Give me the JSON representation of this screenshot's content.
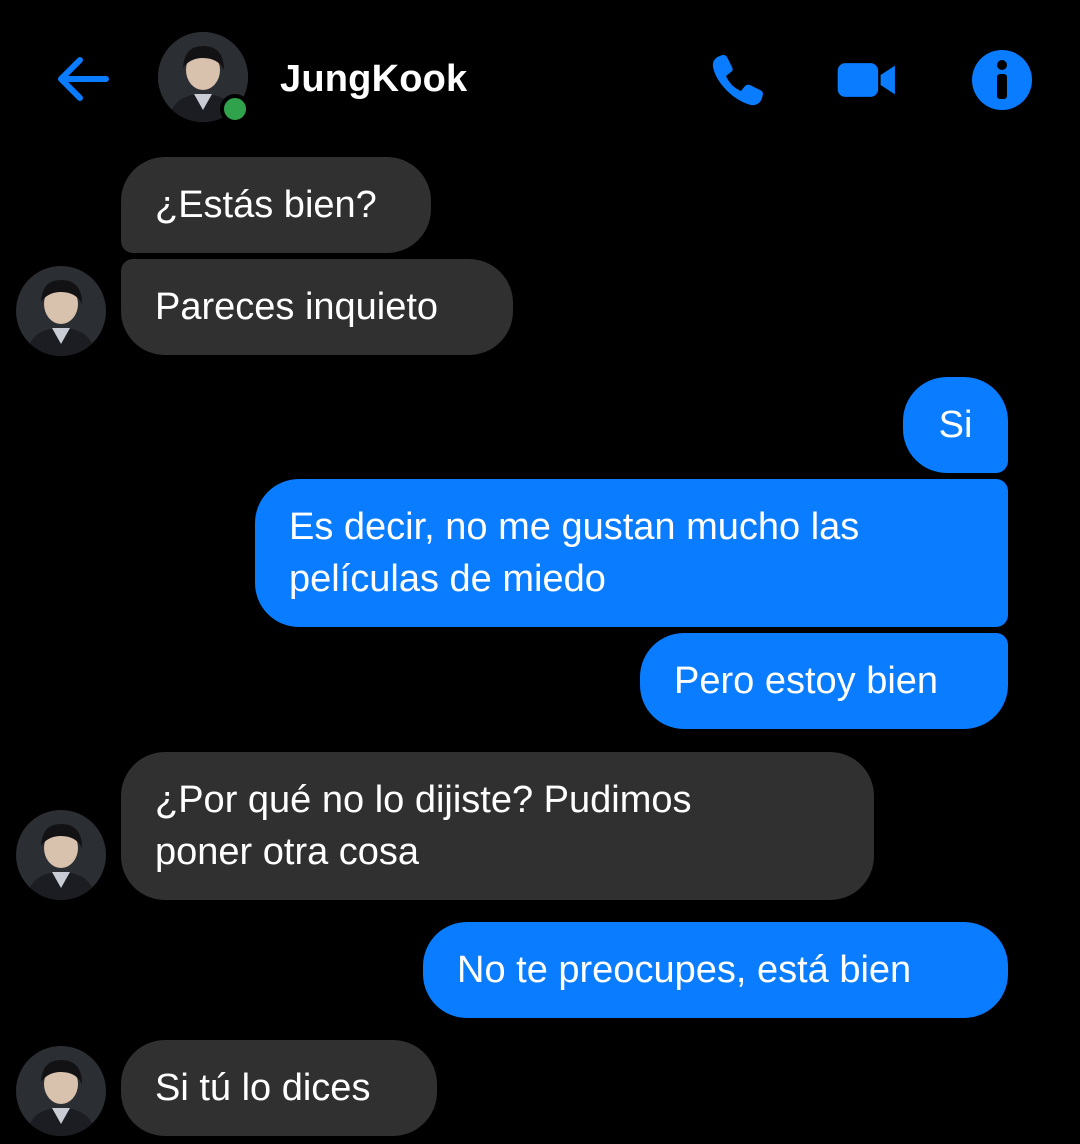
{
  "header": {
    "contact_name": "JungKook",
    "status": "online"
  },
  "colors": {
    "accent": "#0a7cff",
    "incoming_bubble": "#303030",
    "outgoing_bubble": "#0a7cff",
    "online_dot": "#31a24c",
    "background": "#000000"
  },
  "icons": {
    "back": "arrow-left-icon",
    "call": "phone-icon",
    "video": "video-camera-icon",
    "info": "info-icon"
  },
  "messages": [
    {
      "from": "them",
      "text": "¿Estás bien?"
    },
    {
      "from": "them",
      "text": "Pareces inquieto"
    },
    {
      "from": "me",
      "text": "Si"
    },
    {
      "from": "me",
      "text": "Es decir, no me gustan mucho las películas de miedo"
    },
    {
      "from": "me",
      "text": "Pero estoy bien"
    },
    {
      "from": "them",
      "text": "¿Por qué no lo dijiste? Pudimos poner otra cosa"
    },
    {
      "from": "me",
      "text": "No te preocupes, está bien"
    },
    {
      "from": "them",
      "text": "Si tú lo dices"
    }
  ]
}
